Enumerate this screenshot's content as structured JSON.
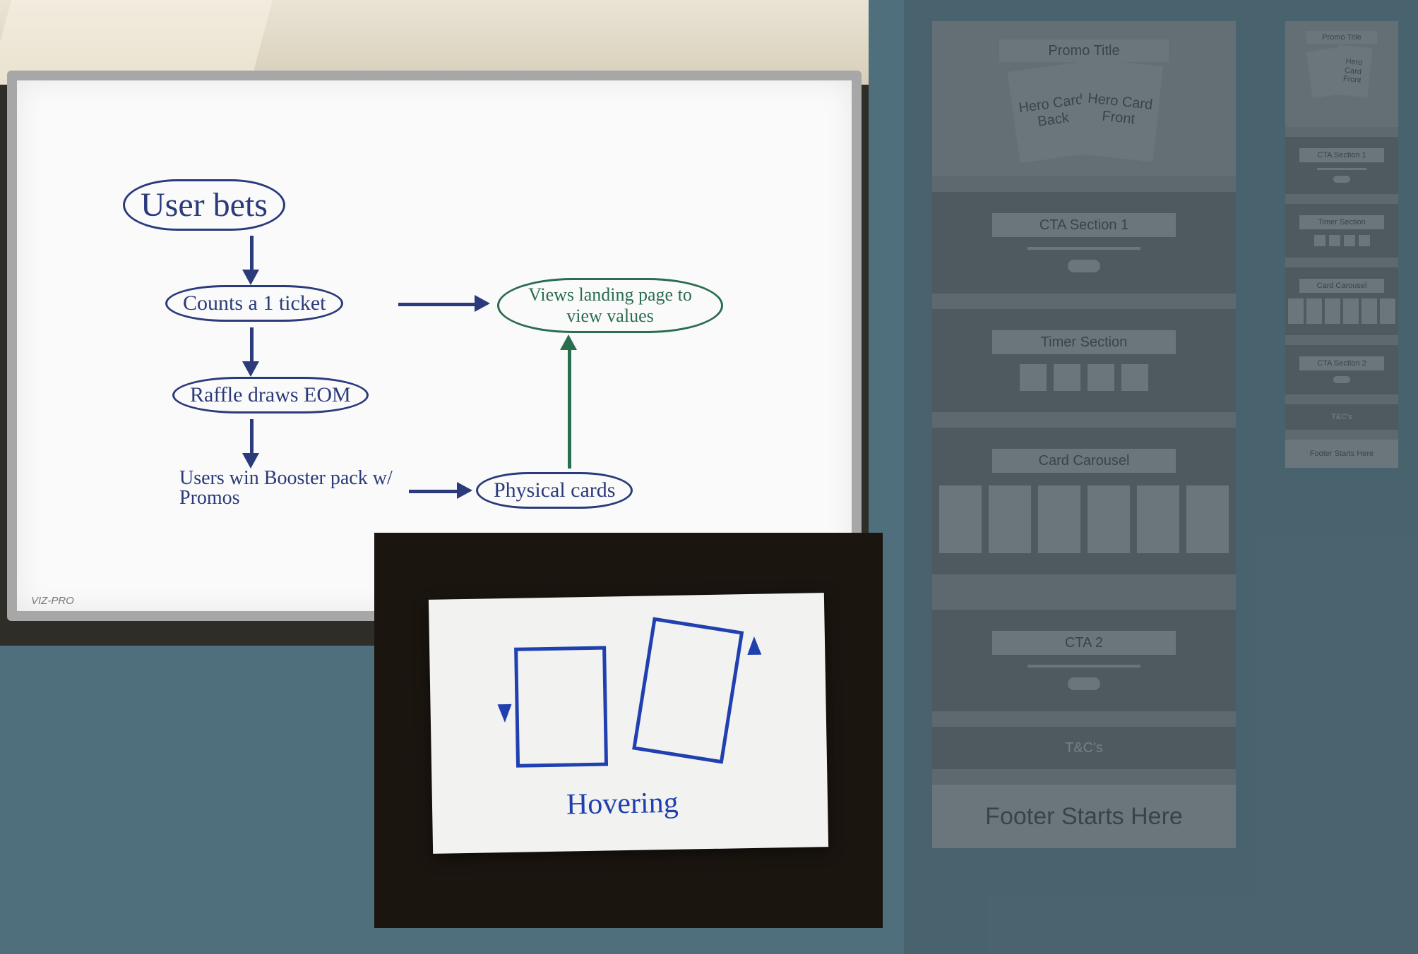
{
  "whiteboard": {
    "nodes": {
      "user_bets": "User bets",
      "counts_ticket": "Counts a 1 ticket",
      "raffle": "Raffle draws EOM",
      "winners": "Users win Booster pack w/ Promos",
      "physical": "Physical cards",
      "landing": "Views landing page to view values"
    },
    "brand": "VIZ-PRO"
  },
  "indexcard": {
    "caption": "Hovering"
  },
  "wireframe": {
    "hero": {
      "title": "Promo Title",
      "card_back": "Hero Card Back",
      "card_front": "Hero Card Front"
    },
    "sections": {
      "cta1": "CTA Section 1",
      "timer": "Timer Section",
      "carousel": "Card Carousel",
      "cta2_large": "CTA 2",
      "cta2_small": "CTA Section 2",
      "tcs": "T&C's",
      "footer": "Footer Starts Here"
    }
  }
}
